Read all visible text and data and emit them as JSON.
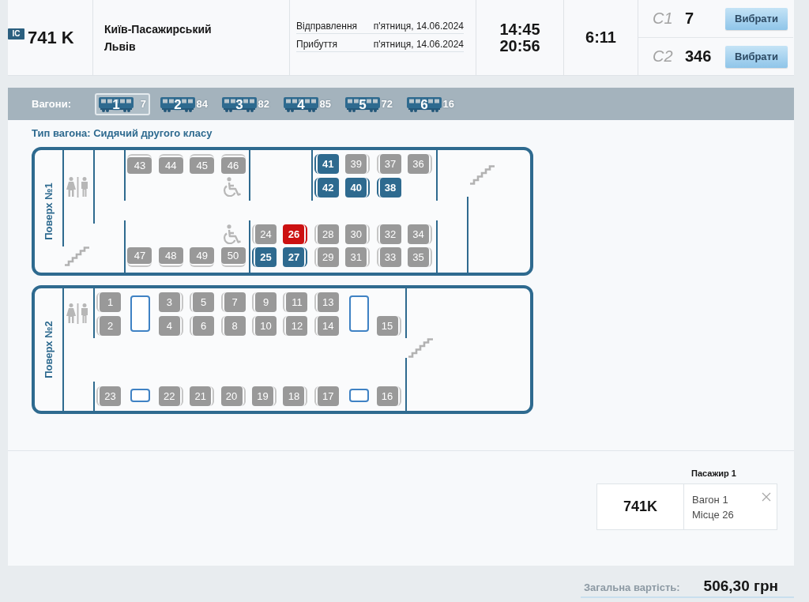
{
  "train": {
    "badge": "IC",
    "number": "741 K",
    "route": {
      "from": "Київ-Пасажирський",
      "to": "Львів"
    },
    "schedule": [
      {
        "label": "Відправлення",
        "date": "п'ятниця, 14.06.2024",
        "time": "14:45"
      },
      {
        "label": "Прибуття",
        "date": "п'ятниця, 14.06.2024",
        "time": "20:56"
      }
    ],
    "duration": "6:11",
    "classes": [
      {
        "name": "С1",
        "seats": "7",
        "button": "Вибрати"
      },
      {
        "name": "С2",
        "seats": "346",
        "button": "Вибрати"
      }
    ]
  },
  "wagons": {
    "label": "Вагони:",
    "items": [
      {
        "number": "1",
        "free": "7",
        "selected": true
      },
      {
        "number": "2",
        "free": "84",
        "selected": false
      },
      {
        "number": "3",
        "free": "82",
        "selected": false
      },
      {
        "number": "4",
        "free": "85",
        "selected": false
      },
      {
        "number": "5",
        "free": "72",
        "selected": false
      },
      {
        "number": "6",
        "free": "16",
        "selected": false
      }
    ]
  },
  "wagon_type": "Тип вагона: Сидячий другого класу",
  "decks": [
    {
      "label": "Поверх №1",
      "seats": [
        {
          "number": "43",
          "available": false,
          "selected": false,
          "kind": "top"
        },
        {
          "number": "44",
          "available": false,
          "selected": false,
          "kind": "top"
        },
        {
          "number": "45",
          "available": false,
          "selected": false,
          "kind": "top"
        },
        {
          "number": "46",
          "available": false,
          "selected": false,
          "kind": "top"
        },
        {
          "number": "41",
          "available": true,
          "selected": false,
          "kind": "left"
        },
        {
          "number": "39",
          "available": false,
          "selected": false,
          "kind": "right"
        },
        {
          "number": "37",
          "available": false,
          "selected": false,
          "kind": "left"
        },
        {
          "number": "36",
          "available": false,
          "selected": false,
          "kind": "right"
        },
        {
          "number": "42",
          "available": true,
          "selected": false,
          "kind": "left"
        },
        {
          "number": "40",
          "available": true,
          "selected": false,
          "kind": "right"
        },
        {
          "number": "38",
          "available": true,
          "selected": false,
          "kind": "left"
        },
        {
          "number": "24",
          "available": false,
          "selected": false,
          "kind": "left"
        },
        {
          "number": "26",
          "available": true,
          "selected": true,
          "kind": "right"
        },
        {
          "number": "28",
          "available": false,
          "selected": false,
          "kind": "left"
        },
        {
          "number": "30",
          "available": false,
          "selected": false,
          "kind": "right"
        },
        {
          "number": "32",
          "available": false,
          "selected": false,
          "kind": "left"
        },
        {
          "number": "34",
          "available": false,
          "selected": false,
          "kind": "right"
        },
        {
          "number": "47",
          "available": false,
          "selected": false,
          "kind": "bottom"
        },
        {
          "number": "48",
          "available": false,
          "selected": false,
          "kind": "bottom"
        },
        {
          "number": "49",
          "available": false,
          "selected": false,
          "kind": "bottom"
        },
        {
          "number": "50",
          "available": false,
          "selected": false,
          "kind": "bottom"
        },
        {
          "number": "25",
          "available": true,
          "selected": false,
          "kind": "left"
        },
        {
          "number": "27",
          "available": true,
          "selected": false,
          "kind": "right"
        },
        {
          "number": "29",
          "available": false,
          "selected": false,
          "kind": "left"
        },
        {
          "number": "31",
          "available": false,
          "selected": false,
          "kind": "right"
        },
        {
          "number": "33",
          "available": false,
          "selected": false,
          "kind": "left"
        },
        {
          "number": "35",
          "available": false,
          "selected": false,
          "kind": "right"
        }
      ]
    },
    {
      "label": "Поверх №2",
      "seats": [
        {
          "number": "1",
          "available": false,
          "selected": false,
          "kind": "left"
        },
        {
          "number": "3",
          "available": false,
          "selected": false,
          "kind": "right"
        },
        {
          "number": "5",
          "available": false,
          "selected": false,
          "kind": "left"
        },
        {
          "number": "7",
          "available": false,
          "selected": false,
          "kind": "left"
        },
        {
          "number": "9",
          "available": false,
          "selected": false,
          "kind": "left"
        },
        {
          "number": "11",
          "available": false,
          "selected": false,
          "kind": "left"
        },
        {
          "number": "13",
          "available": false,
          "selected": false,
          "kind": "left"
        },
        {
          "number": "2",
          "available": false,
          "selected": false,
          "kind": "left"
        },
        {
          "number": "4",
          "available": false,
          "selected": false,
          "kind": "right"
        },
        {
          "number": "6",
          "available": false,
          "selected": false,
          "kind": "left"
        },
        {
          "number": "8",
          "available": false,
          "selected": false,
          "kind": "left"
        },
        {
          "number": "10",
          "available": false,
          "selected": false,
          "kind": "left"
        },
        {
          "number": "12",
          "available": false,
          "selected": false,
          "kind": "left"
        },
        {
          "number": "14",
          "available": false,
          "selected": false,
          "kind": "left"
        },
        {
          "number": "15",
          "available": false,
          "selected": false,
          "kind": "right"
        },
        {
          "number": "23",
          "available": false,
          "selected": false,
          "kind": "left"
        },
        {
          "number": "22",
          "available": false,
          "selected": false,
          "kind": "right"
        },
        {
          "number": "21",
          "available": false,
          "selected": false,
          "kind": "right"
        },
        {
          "number": "20",
          "available": false,
          "selected": false,
          "kind": "right"
        },
        {
          "number": "19",
          "available": false,
          "selected": false,
          "kind": "right"
        },
        {
          "number": "18",
          "available": false,
          "selected": false,
          "kind": "right"
        },
        {
          "number": "17",
          "available": false,
          "selected": false,
          "kind": "left"
        },
        {
          "number": "16",
          "available": false,
          "selected": false,
          "kind": "right"
        }
      ]
    }
  ],
  "passengers": [
    {
      "title": "Пасажир 1",
      "train": "741K",
      "wagon": "Вагон 1",
      "seat": "Місце 26"
    }
  ],
  "total": {
    "label": "Загальна вартість:",
    "value": "506,30 грн"
  }
}
